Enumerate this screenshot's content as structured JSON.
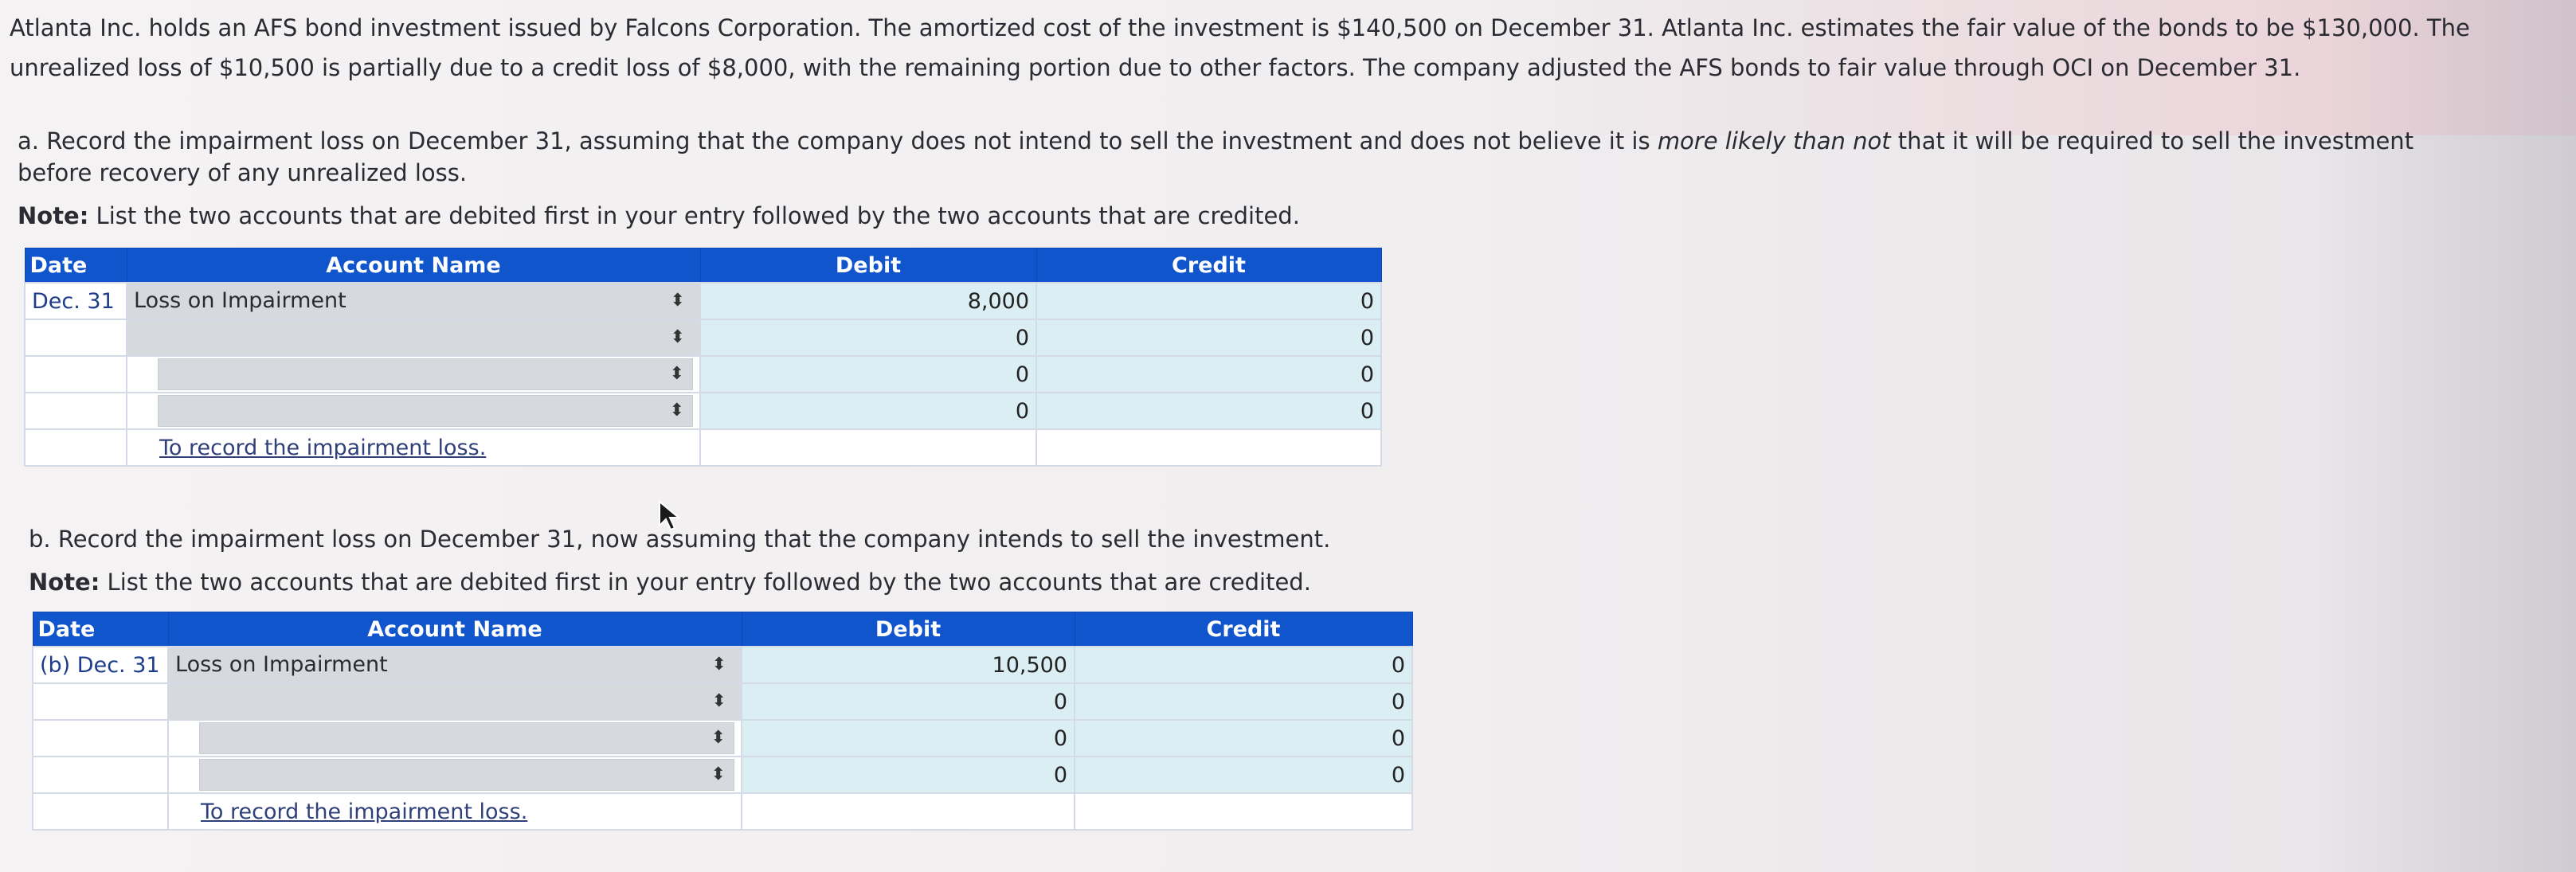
{
  "intro": {
    "line1": "Atlanta Inc. holds an AFS bond investment issued by Falcons Corporation. The amortized cost of the investment is $140,500 on December 31. Atlanta Inc. estimates the fair value of the bonds to be $130,000. The",
    "line2": "unrealized loss of $10,500 is partially due to a credit loss of $8,000, with the remaining portion due to other factors. The company adjusted the AFS bonds to fair value through OCI on December 31."
  },
  "part_a": {
    "prompt_start": "a. Record the impairment loss on December 31, assuming that the company does not intend to sell the investment and does not believe it is ",
    "prompt_italic": "more likely than not",
    "prompt_end": " that it will be required to sell the investment",
    "prompt_line2": "before recovery of any unrealized loss.",
    "note_label": "Note:",
    "note_text": " List the two accounts that are debited first in your entry followed by the two accounts that are credited.",
    "table": {
      "headers": {
        "date": "Date",
        "account": "Account Name",
        "debit": "Debit",
        "credit": "Credit"
      },
      "rows": [
        {
          "date": "Dec. 31",
          "account": "Loss on Impairment",
          "debit": "8,000",
          "credit": "0"
        },
        {
          "date": "",
          "account": "",
          "debit": "0",
          "credit": "0"
        },
        {
          "date": "",
          "account": "",
          "debit": "0",
          "credit": "0"
        },
        {
          "date": "",
          "account": "",
          "debit": "0",
          "credit": "0"
        }
      ],
      "memo": "To record the impairment loss."
    }
  },
  "part_b": {
    "prompt": "b. Record the impairment loss on December 31, now assuming that the company intends to sell the investment.",
    "note_label": "Note:",
    "note_text": " List the two accounts that are debited first in your entry followed by the two accounts that are credited.",
    "table": {
      "headers": {
        "date": "Date",
        "account": "Account Name",
        "debit": "Debit",
        "credit": "Credit"
      },
      "rows": [
        {
          "date": "(b) Dec. 31",
          "account": "Loss on Impairment",
          "debit": "10,500",
          "credit": "0"
        },
        {
          "date": "",
          "account": "",
          "debit": "0",
          "credit": "0"
        },
        {
          "date": "",
          "account": "",
          "debit": "0",
          "credit": "0"
        },
        {
          "date": "",
          "account": "",
          "debit": "0",
          "credit": "0"
        }
      ],
      "memo": "To record the impairment loss."
    }
  },
  "icons": {
    "spinner": "updown-spinner-icon",
    "cursor": "mouse-pointer-icon"
  },
  "colors": {
    "header_blue": "#1155cc",
    "amount_cell": "#daeef3",
    "account_cell": "#d6dadf"
  }
}
